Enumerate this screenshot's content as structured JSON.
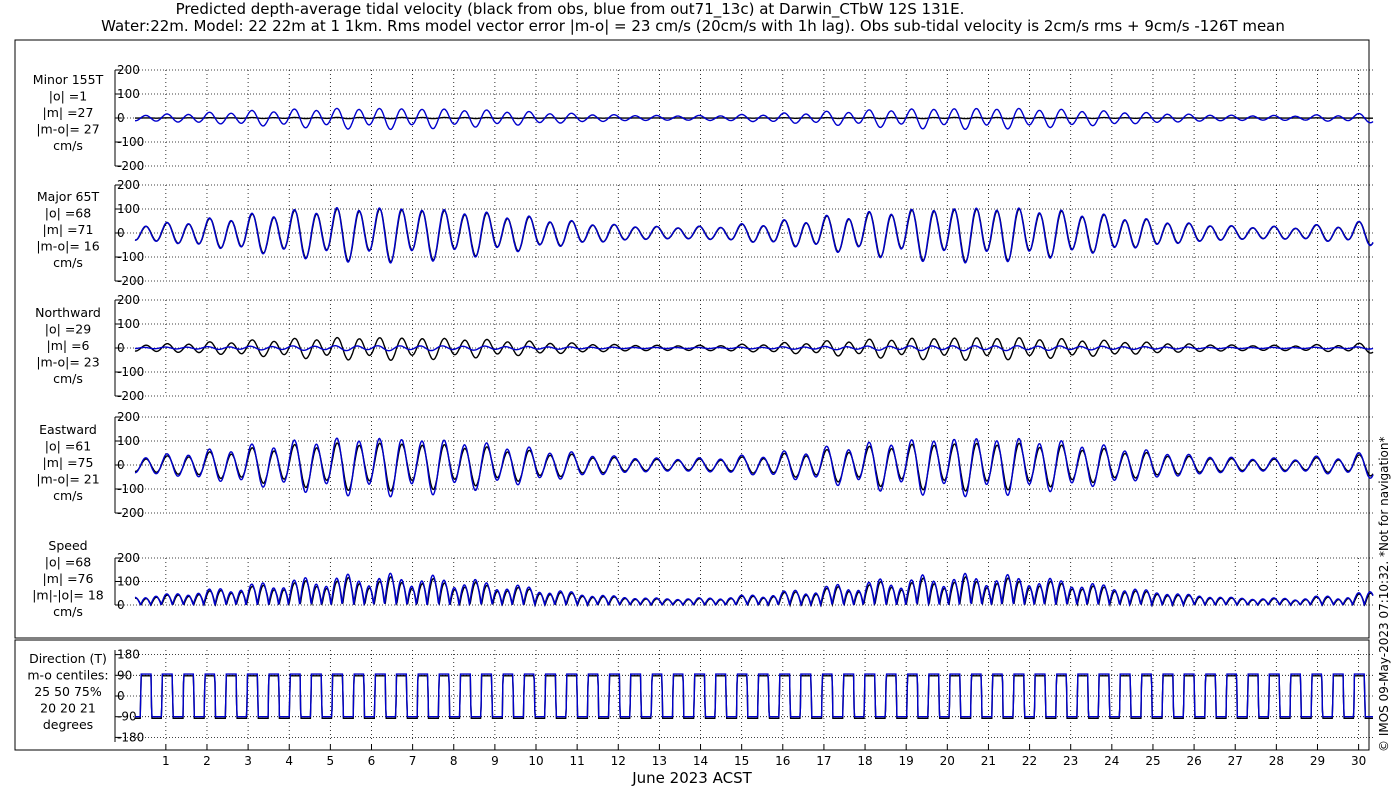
{
  "title": {
    "line1": "Predicted depth-average tidal velocity (black from obs, blue from out71_13c) at Darwin_CTbW 12S 131E.",
    "line2": "Water:22m. Model: 22 22m at 1 1km. Rms model vector error |m-o| = 23 cm/s (20cm/s with 1h lag). Obs sub-tidal velocity is 2cm/s rms + 9cm/s -126T mean"
  },
  "side_note": "© IMOS 09-May-2023 07:10:32. *Not for navigation*",
  "colors": {
    "obs": "#000000",
    "model": "#0000cc"
  },
  "chart_data": {
    "type": "line",
    "xlabel": "June 2023 ACST",
    "x_ticks": [
      1,
      2,
      3,
      4,
      5,
      6,
      7,
      8,
      9,
      10,
      11,
      12,
      13,
      14,
      15,
      16,
      17,
      18,
      19,
      20,
      21,
      22,
      23,
      24,
      25,
      26,
      27,
      28,
      29,
      30
    ],
    "xlim": [
      0.25,
      30.35
    ],
    "series_legend": [
      "black from obs",
      "blue from out71_13c"
    ],
    "panels": [
      {
        "id": "minor",
        "labels": [
          "Minor 155T",
          "|o| =1",
          "|m| =27",
          "|m-o|= 27",
          "cm/s"
        ],
        "ylim": [
          -200,
          200
        ],
        "yticks": [
          200,
          100,
          0,
          -100,
          -200
        ],
        "obs_amp": 2,
        "model_amp": 38
      },
      {
        "id": "major",
        "labels": [
          "Major 65T",
          "|o| =68",
          "|m| =71",
          "|m-o|= 16",
          "cm/s"
        ],
        "ylim": [
          -200,
          200
        ],
        "yticks": [
          200,
          100,
          0,
          -100,
          -200
        ],
        "obs_amp": 96,
        "model_amp": 100
      },
      {
        "id": "north",
        "labels": [
          "Northward",
          "|o| =29",
          "|m| =6",
          "|m-o|= 23",
          "cm/s"
        ],
        "ylim": [
          -200,
          200
        ],
        "yticks": [
          200,
          100,
          0,
          -100,
          -200
        ],
        "obs_amp": 41,
        "model_amp": 9
      },
      {
        "id": "east",
        "labels": [
          "Eastward",
          "|o| =61",
          "|m| =75",
          "|m-o|= 21",
          "cm/s"
        ],
        "ylim": [
          -200,
          200
        ],
        "yticks": [
          200,
          100,
          0,
          -100,
          -200
        ],
        "obs_amp": 87,
        "model_amp": 106
      },
      {
        "id": "speed",
        "labels": [
          "Speed",
          "|o| =68",
          "|m| =76",
          "|m|-|o|= 18",
          "cm/s"
        ],
        "ylim": [
          0,
          200
        ],
        "yticks": [
          200,
          100,
          0
        ],
        "obs_amp": 96,
        "model_amp": 105
      },
      {
        "id": "direction",
        "labels": [
          "Direction (T)",
          "m-o centiles:",
          "25  50  75%",
          "20  20  21",
          "degrees"
        ],
        "ylim": [
          -200,
          200
        ],
        "yticks": [
          180,
          90,
          0,
          -90,
          -180
        ]
      }
    ]
  }
}
